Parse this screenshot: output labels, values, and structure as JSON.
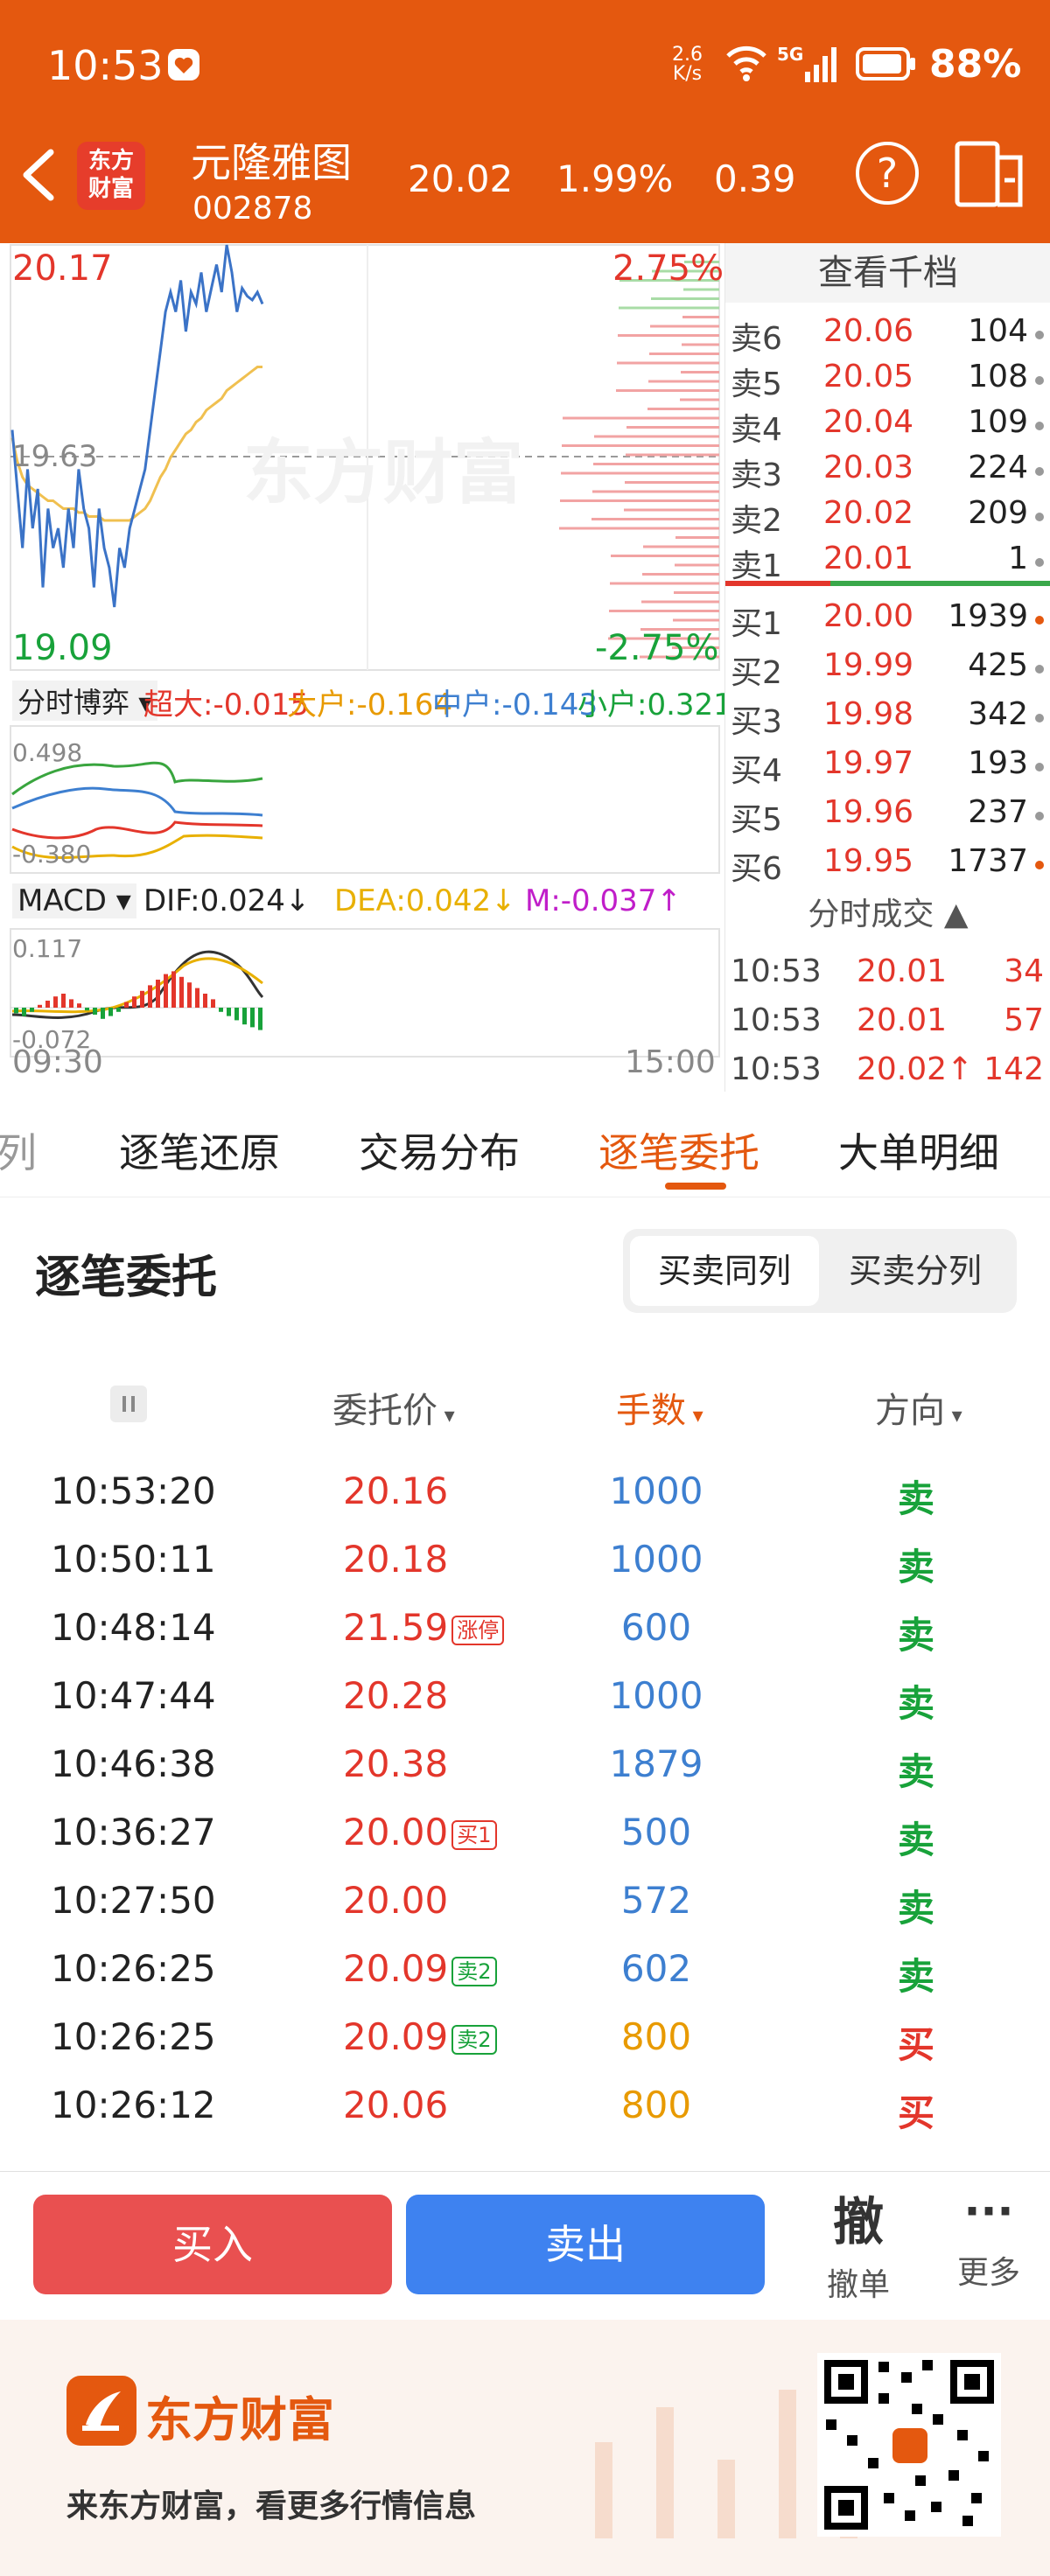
{
  "status_bar": {
    "time": "10:53",
    "net_speed_top": "2.6",
    "net_speed_unit": "K/s",
    "signal_label": "5G",
    "battery": "88%"
  },
  "header": {
    "logo_line1": "东方",
    "logo_line2": "财富",
    "stock_name": "元隆雅图",
    "stock_code": "002878",
    "price": "20.02",
    "change_pct": "1.99%",
    "change": "0.39"
  },
  "chart": {
    "high_price": "20.17",
    "low_price": "19.09",
    "high_pct": "2.75%",
    "low_pct": "-2.75%",
    "mid_price": "19.63",
    "watermark": "东方财富",
    "open_time": "09:30",
    "close_time": "15:00",
    "boyi": {
      "selector": "分时博弈",
      "super_label": "超大:",
      "super": "-0.015",
      "big_label": "大户:",
      "big": "-0.164",
      "mid_label": "中户:",
      "mid": "-0.143",
      "small_label": "小户:",
      "small": "0.321",
      "axis_top": "0.498",
      "axis_bottom": "-0.380"
    },
    "macd": {
      "selector": "MACD",
      "dif": "DIF:0.024",
      "dif_arrow": "↓",
      "dea": "DEA:0.042",
      "dea_arrow": "↓",
      "m": "M:-0.037",
      "m_arrow": "↑",
      "axis_top": "0.117",
      "axis_bottom": "-0.072"
    },
    "price_series": [
      19.7,
      19.55,
      19.4,
      19.6,
      19.45,
      19.55,
      19.3,
      19.5,
      19.4,
      19.45,
      19.35,
      19.5,
      19.4,
      19.6,
      19.5,
      19.45,
      19.3,
      19.5,
      19.4,
      19.35,
      19.25,
      19.4,
      19.35,
      19.45,
      19.5,
      19.55,
      19.6,
      19.7,
      19.8,
      19.9,
      20.0,
      20.05,
      20.0,
      20.08,
      19.95,
      20.05,
      20.02,
      20.1,
      20.0,
      20.06,
      20.12,
      20.05,
      20.17,
      20.1,
      20.0,
      20.06,
      20.04,
      20.03,
      20.05,
      20.02
    ],
    "avg_series": [
      19.68,
      19.62,
      19.58,
      19.56,
      19.55,
      19.54,
      19.53,
      19.52,
      19.52,
      19.51,
      19.5,
      19.5,
      19.5,
      19.49,
      19.49,
      19.48,
      19.48,
      19.48,
      19.47,
      19.47,
      19.47,
      19.47,
      19.47,
      19.47,
      19.48,
      19.49,
      19.5,
      19.52,
      19.55,
      19.58,
      19.6,
      19.63,
      19.65,
      19.67,
      19.69,
      19.7,
      19.72,
      19.73,
      19.75,
      19.76,
      19.77,
      19.78,
      19.8,
      19.81,
      19.82,
      19.83,
      19.84,
      19.85,
      19.86,
      19.86
    ]
  },
  "book": {
    "title": "查看千档",
    "asks": [
      {
        "label": "卖6",
        "price": "20.06",
        "vol": "104"
      },
      {
        "label": "卖5",
        "price": "20.05",
        "vol": "108"
      },
      {
        "label": "卖4",
        "price": "20.04",
        "vol": "109"
      },
      {
        "label": "卖3",
        "price": "20.03",
        "vol": "224"
      },
      {
        "label": "卖2",
        "price": "20.02",
        "vol": "209"
      },
      {
        "label": "卖1",
        "price": "20.01",
        "vol": "1"
      }
    ],
    "bids": [
      {
        "label": "买1",
        "price": "20.00",
        "vol": "1939"
      },
      {
        "label": "买2",
        "price": "19.99",
        "vol": "425"
      },
      {
        "label": "买3",
        "price": "19.98",
        "vol": "342"
      },
      {
        "label": "买4",
        "price": "19.97",
        "vol": "193"
      },
      {
        "label": "买5",
        "price": "19.96",
        "vol": "237"
      },
      {
        "label": "买6",
        "price": "19.95",
        "vol": "1737"
      }
    ],
    "ticks_title": "分时成交",
    "ticks": [
      {
        "time": "10:53",
        "price": "20.01",
        "vol": "34"
      },
      {
        "time": "10:53",
        "price": "20.01",
        "vol": "57"
      },
      {
        "time": "10:53",
        "price": "20.02↑",
        "vol": "142"
      }
    ]
  },
  "tabs": [
    "列",
    "逐笔还原",
    "交易分布",
    "逐笔委托",
    "大单明细"
  ],
  "entrust": {
    "title": "逐笔委托",
    "seg_same": "买卖同列",
    "seg_split": "买卖分列",
    "col_price": "委托价",
    "col_vol": "手数",
    "col_dir": "方向",
    "rows": [
      {
        "time": "10:53:20",
        "price": "20.16",
        "tag": "",
        "vol": "1000",
        "dir": "卖"
      },
      {
        "time": "10:50:11",
        "price": "20.18",
        "tag": "",
        "vol": "1000",
        "dir": "卖"
      },
      {
        "time": "10:48:14",
        "price": "21.59",
        "tag": "涨停",
        "vol": "600",
        "dir": "卖"
      },
      {
        "time": "10:47:44",
        "price": "20.28",
        "tag": "",
        "vol": "1000",
        "dir": "卖"
      },
      {
        "time": "10:46:38",
        "price": "20.38",
        "tag": "",
        "vol": "1879",
        "dir": "卖"
      },
      {
        "time": "10:36:27",
        "price": "20.00",
        "tag": "买1",
        "vol": "500",
        "dir": "卖"
      },
      {
        "time": "10:27:50",
        "price": "20.00",
        "tag": "",
        "vol": "572",
        "dir": "卖"
      },
      {
        "time": "10:26:25",
        "price": "20.09",
        "tag": "卖2",
        "vol": "602",
        "dir": "卖"
      },
      {
        "time": "10:26:25",
        "price": "20.09",
        "tag": "卖2",
        "vol": "800",
        "dir": "买"
      },
      {
        "time": "10:26:12",
        "price": "20.06",
        "tag": "",
        "vol": "800",
        "dir": "买"
      }
    ]
  },
  "actions": {
    "buy": "买入",
    "sell": "卖出",
    "cancel_icon": "撤",
    "cancel": "撤单",
    "more": "更多"
  },
  "ad": {
    "brand": "东方财富",
    "slogan": "来东方财富，看更多行情信息"
  },
  "colors": {
    "header_bg": "#e4580f",
    "up": "#e3362b",
    "down": "#18a23a",
    "buy_btn": "#e95050",
    "sell_btn": "#3e82f0"
  }
}
